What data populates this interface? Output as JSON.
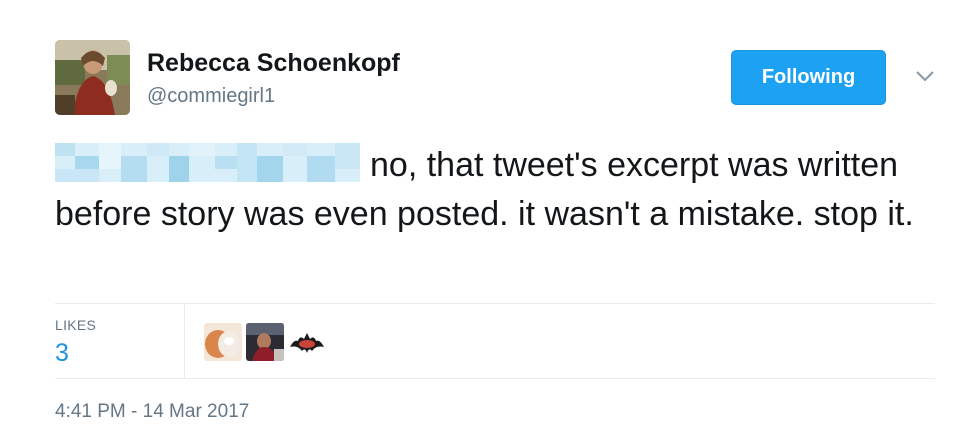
{
  "user": {
    "display_name": "Rebecca Schoenkopf",
    "screen_name": "@commiegirl1",
    "avatar_icon": "profile-photo"
  },
  "follow_button": {
    "label": "Following",
    "color": "#1da1f2"
  },
  "menu_caret_icon": "chevron-down-icon",
  "tweet": {
    "text": "no, that tweet's excerpt was written before story was even posted. it wasn't a mistake. stop it.",
    "mention_redacted": true
  },
  "stats": {
    "likes_label": "LIKES",
    "likes_count": "3",
    "likers": [
      "liker-avatar-1",
      "liker-avatar-2",
      "liker-avatar-3"
    ]
  },
  "timestamp": "4:41 PM - 14 Mar 2017",
  "colors": {
    "accent": "#1b95e0",
    "muted": "#657786",
    "divider": "#e6ecf0"
  }
}
